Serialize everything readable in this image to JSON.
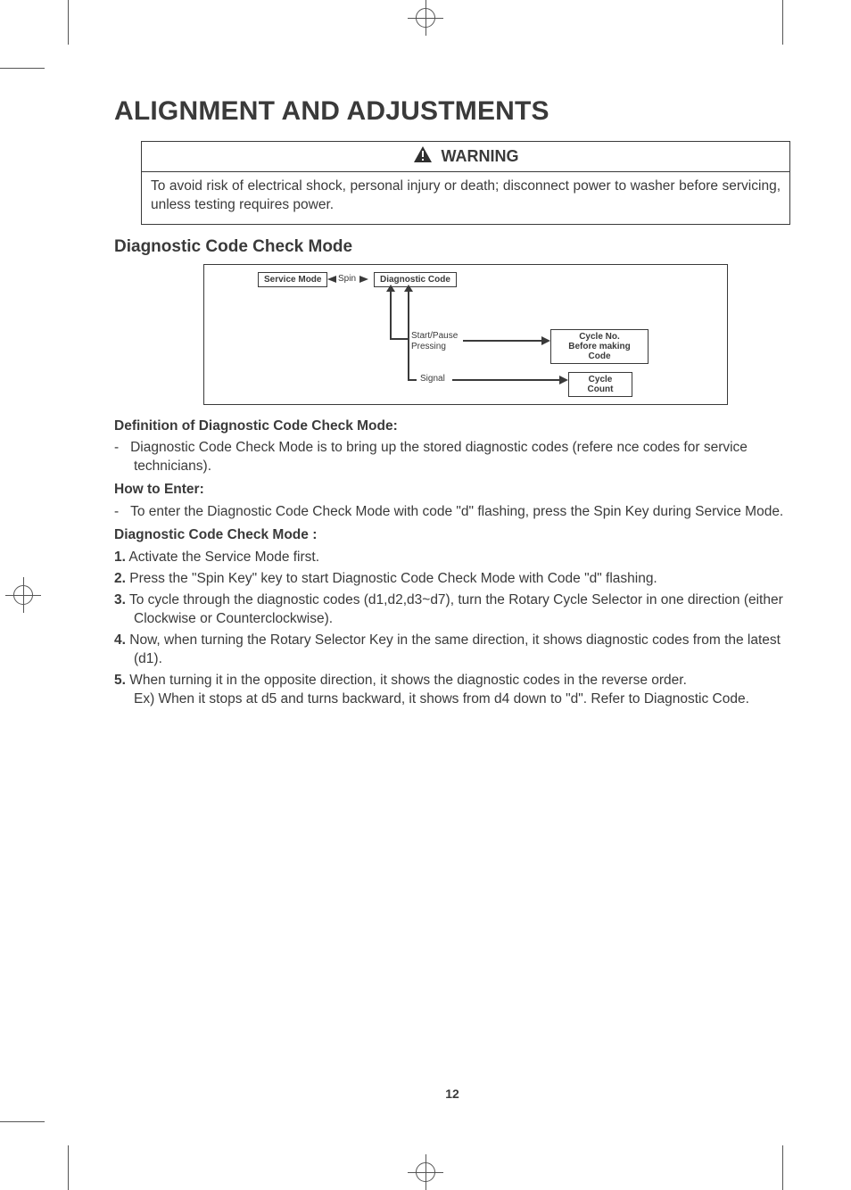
{
  "title": "ALIGNMENT AND ADJUSTMENTS",
  "warning": {
    "label": "WARNING",
    "text": "To avoid risk of electrical shock, personal injury or death; disconnect power to washer before servicing, unless testing requires power."
  },
  "section_heading": "Diagnostic Code Check Mode",
  "diagram": {
    "service_mode": "Service Mode",
    "spin": "Spin",
    "diagnostic_code": "Diagnostic Code",
    "start_pause": "Start/Pause",
    "pressing": "Pressing",
    "cycle_no": "Cycle No.",
    "before_making": "Before making Code",
    "signal": "Signal",
    "cycle_count": "Cycle Count"
  },
  "definition_hdr": "Definition of Diagnostic Code Check Mode:",
  "definition_item": "Diagnostic Code Check Mode is to bring up the stored diagnostic codes (refere nce codes for service technicians).",
  "howto_hdr": "How to Enter:",
  "howto_item": "To enter the Diagnostic Code Check Mode with code \"d\" flashing, press the Spin Key during Service Mode.",
  "mode_hdr": "Diagnostic Code Check Mode :",
  "steps": {
    "s1": "Activate the Service Mode first.",
    "s2": "Press the \"Spin Key\" key to start Diagnostic Code Check Mode with Code \"d\" flashing.",
    "s3": "To cycle through the diagnostic codes (d1,d2,d3~d7), turn the Rotary Cycle Selector in one direction (either Clockwise or Counterclockwise).",
    "s4": "Now, when turning the Rotary Selector Key in the same direction, it shows diagnostic codes from the latest (d1).",
    "s5a": "When turning it in the opposite direction, it shows the diagnostic codes in the reverse order.",
    "s5b": "Ex) When it stops at d5 and turns backward, it shows from d4 down to \"d\". Refer to Diagnostic Code."
  },
  "page_number": "12"
}
